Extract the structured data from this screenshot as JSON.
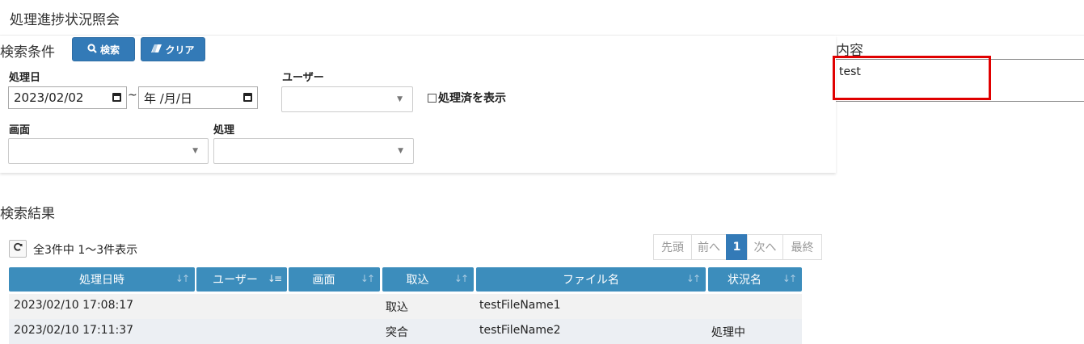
{
  "page_title": "処理進捗状況照会",
  "search": {
    "title": "検索条件",
    "search_button": "検索",
    "clear_button": "クリア",
    "date_label": "処理日",
    "date_from": "2023/02/02",
    "date_sep": "~",
    "date_to": "年 /月/日",
    "user_label": "ユーザー",
    "show_processed_label": "処理済を表示",
    "screen_label": "画面",
    "process_label": "処理"
  },
  "content": {
    "label": "内容",
    "value": "test"
  },
  "results": {
    "title": "検索結果",
    "count_text": "全3件中 1～3件表示",
    "pager": [
      "先頭",
      "前へ",
      "1",
      "次へ",
      "最終"
    ],
    "columns": [
      "処理日時",
      "ユーザー",
      "画面",
      "取込",
      "ファイル名",
      "状況名"
    ],
    "rows": [
      [
        "2023/02/10 17:08:17",
        "",
        "",
        "取込",
        "testFileName1",
        ""
      ],
      [
        "2023/02/10 17:11:37",
        "",
        "",
        "突合",
        "testFileName2",
        "処理中"
      ]
    ]
  },
  "colors": {
    "primary": "#337ab7",
    "header": "#3c8dbc",
    "highlight": "#e00000"
  }
}
